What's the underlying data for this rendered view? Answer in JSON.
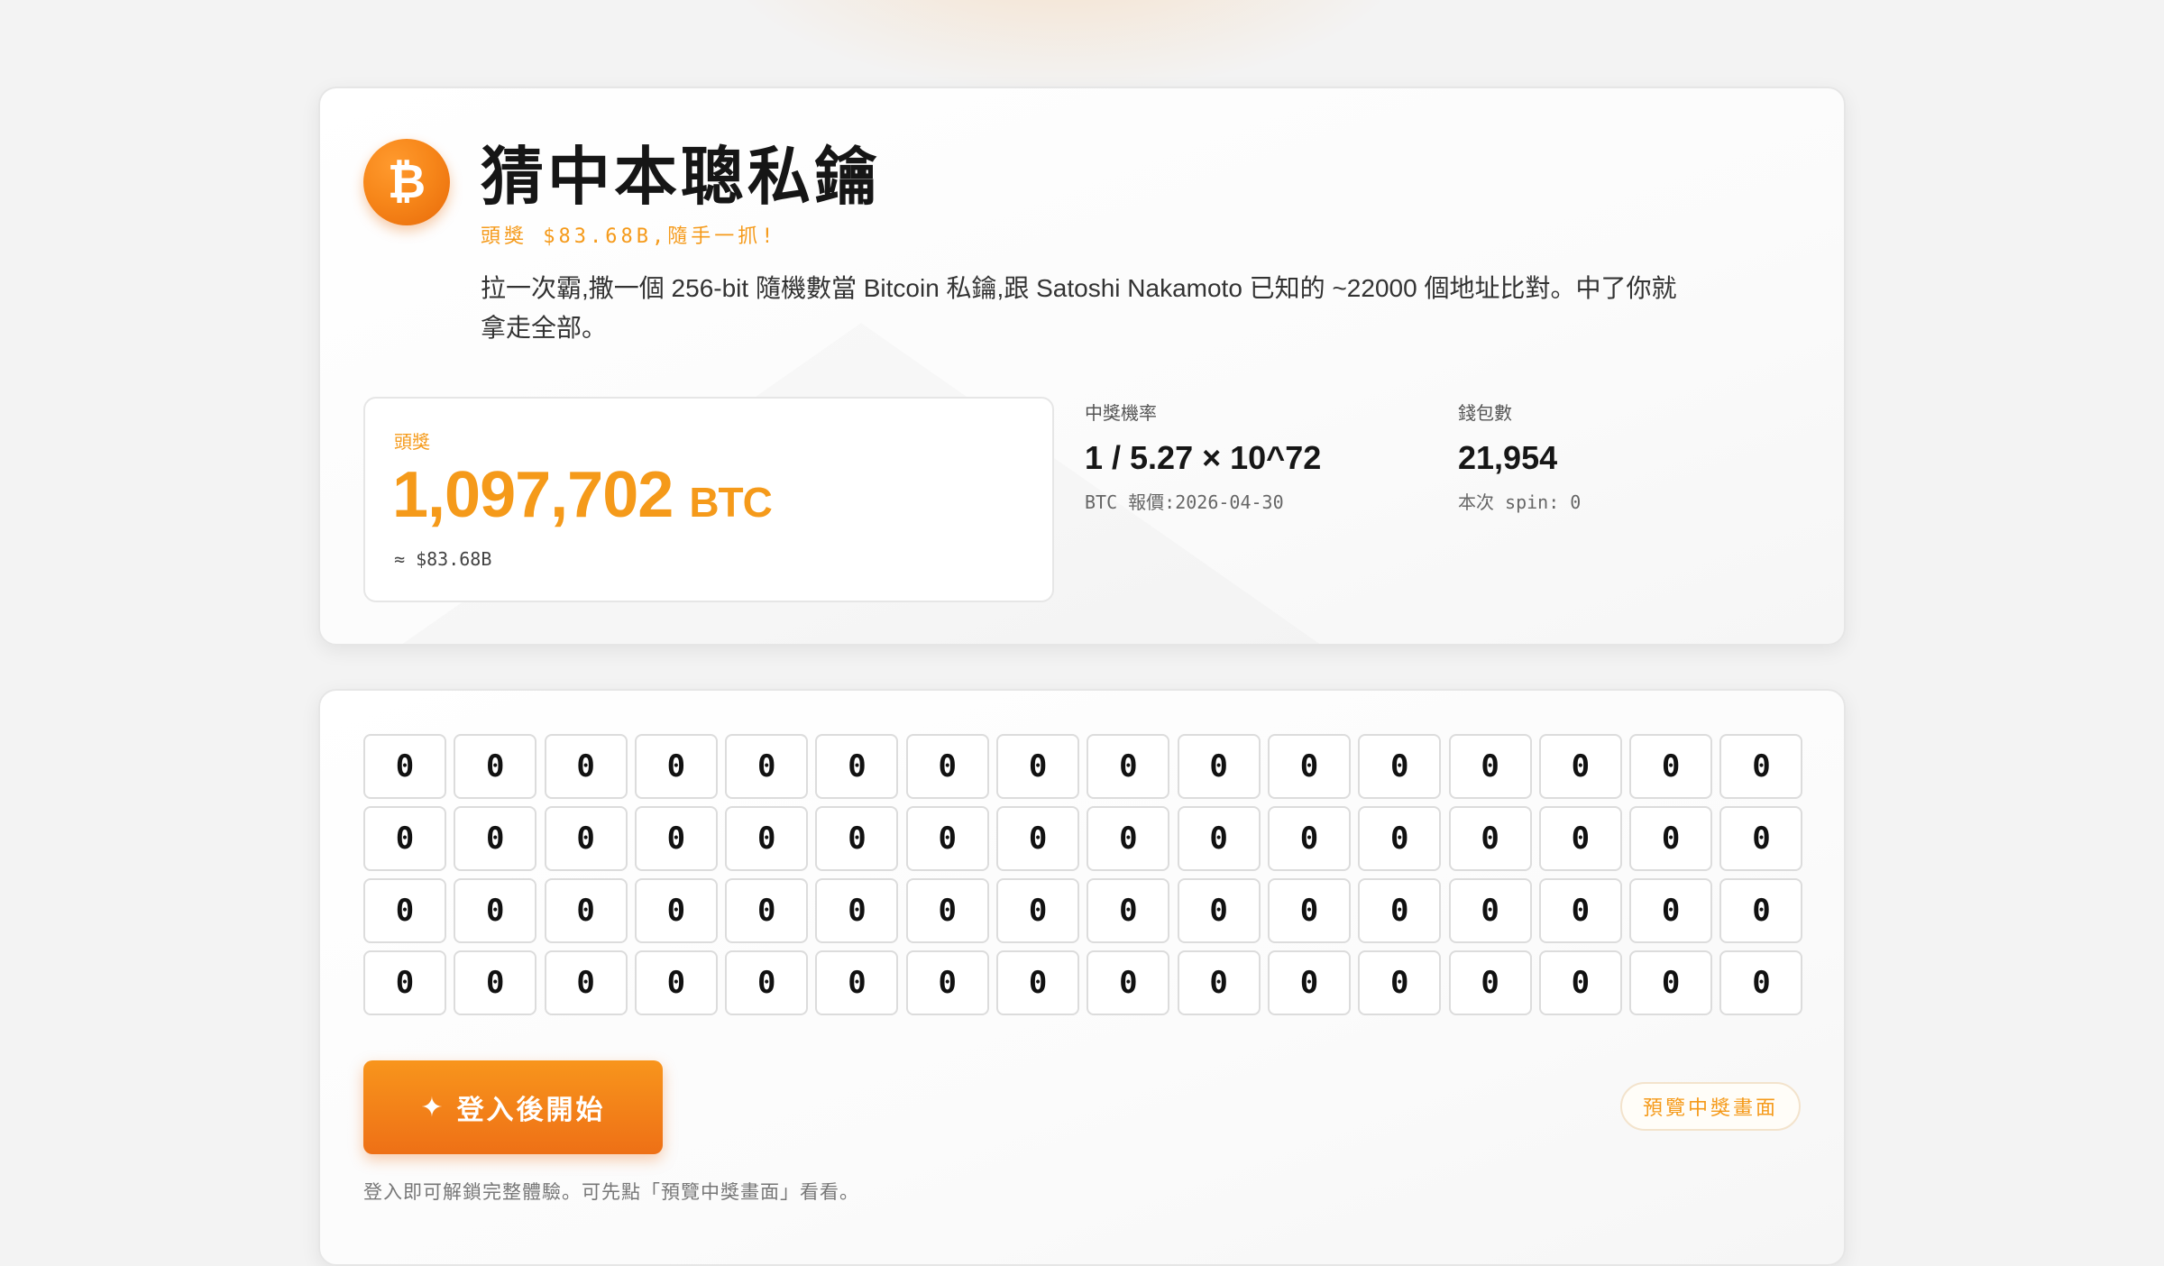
{
  "header": {
    "logo_glyph": "₿",
    "title": "猜中本聰私鑰",
    "jackpot_tag": "頭獎 $83.68B,隨手一抓!",
    "intro": "拉一次霸,撒一個 256-bit 隨機數當 Bitcoin 私鑰,跟 Satoshi Nakamoto 已知的 ~22000 個地址比對。中了你就拿走全部。"
  },
  "prize": {
    "label": "頭獎",
    "amount": "1,097,702",
    "unit": "BTC",
    "usd": "≈ $83.68B"
  },
  "stats": {
    "odds": {
      "label": "中獎機率",
      "value": "1 / 5.27 × 10^72",
      "sub": "BTC 報價:2026-04-30"
    },
    "wallets": {
      "label": "錢包數",
      "value": "21,954",
      "sub": "本次 spin: 0"
    }
  },
  "grid": {
    "rows": [
      [
        "0",
        "0",
        "0",
        "0",
        "0",
        "0",
        "0",
        "0",
        "0",
        "0",
        "0",
        "0",
        "0",
        "0",
        "0",
        "0"
      ],
      [
        "0",
        "0",
        "0",
        "0",
        "0",
        "0",
        "0",
        "0",
        "0",
        "0",
        "0",
        "0",
        "0",
        "0",
        "0",
        "0"
      ],
      [
        "0",
        "0",
        "0",
        "0",
        "0",
        "0",
        "0",
        "0",
        "0",
        "0",
        "0",
        "0",
        "0",
        "0",
        "0",
        "0"
      ],
      [
        "0",
        "0",
        "0",
        "0",
        "0",
        "0",
        "0",
        "0",
        "0",
        "0",
        "0",
        "0",
        "0",
        "0",
        "0",
        "0"
      ]
    ]
  },
  "actions": {
    "spin_icon": "sparkle-icon",
    "spin_glyph": "✦",
    "spin_label": "登入後開始",
    "preview_label": "預覽中獎畫面",
    "hint": "登入即可解鎖完整體驗。可先點「預覽中獎畫面」看看。"
  },
  "colors": {
    "accent": "#f59a1a",
    "button_top": "#f8951c",
    "button_bottom": "#ee7016"
  }
}
